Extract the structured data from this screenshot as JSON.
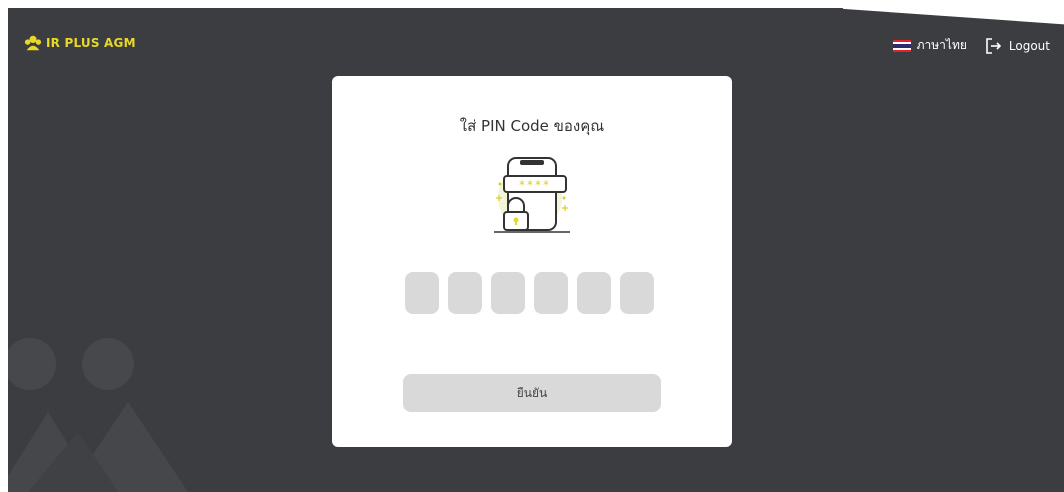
{
  "app": {
    "brand": "IR PLUS AGM"
  },
  "header": {
    "language_label": "ภาษาไทย",
    "language_flag_icon": "thailand-flag-icon",
    "logout_label": "Logout",
    "logout_icon": "logout-icon"
  },
  "pin_card": {
    "title": "ใส่ PIN Code ของคุณ",
    "illustration_icon": "phone-lock-pin-icon",
    "pin_mask": "****",
    "pin_length": 6,
    "pin_values": [
      "",
      "",
      "",
      "",
      "",
      ""
    ],
    "confirm_label": "ยืนยัน"
  },
  "colors": {
    "background": "#3b3d41",
    "brand_accent": "#e8d928",
    "card": "#ffffff",
    "input_fill": "#d9d9d9"
  }
}
